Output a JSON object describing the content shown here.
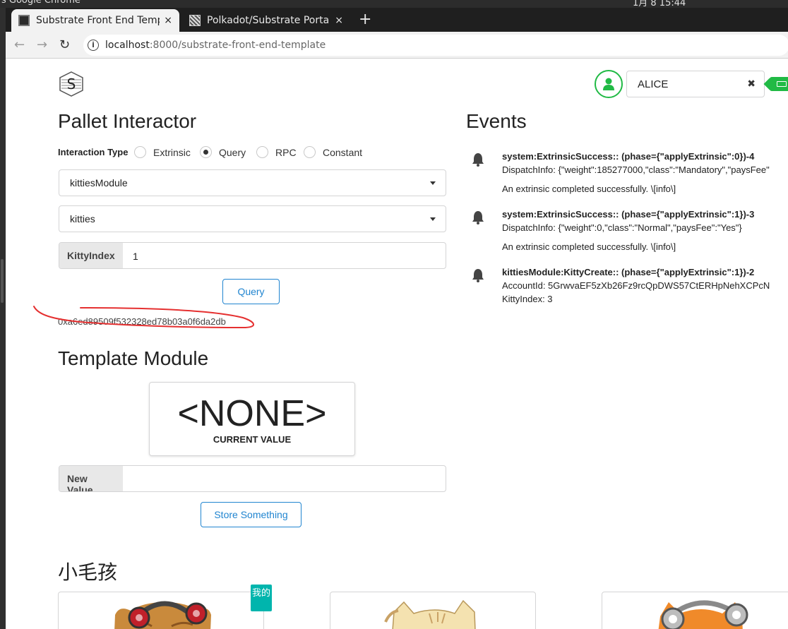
{
  "os": {
    "left_text": "s   Google Chrome",
    "right_text": "1月 8  15:44"
  },
  "tabs": [
    {
      "title": "Substrate Front End Temp",
      "close": "×"
    },
    {
      "title": "Polkadot/Substrate Porta",
      "close": "×"
    }
  ],
  "newtab_label": "+",
  "address": {
    "host": "localhost",
    "path": ":8000/substrate-front-end-template"
  },
  "account": {
    "name": "ALICE",
    "clear": "✖"
  },
  "pallet": {
    "title": "Pallet Interactor",
    "interaction_type_label": "Interaction Type",
    "radios": [
      "Extrinsic",
      "Query",
      "RPC",
      "Constant"
    ],
    "selected_radio": "Query",
    "module": "kittiesModule",
    "call": "kitties",
    "param_label": "KittyIndex",
    "param_value": "1",
    "query_button": "Query",
    "result": "0xa6ed89509f532328ed78b03a0f6da2db"
  },
  "template": {
    "title": "Template Module",
    "current_value": "<NONE>",
    "current_value_label": "CURRENT VALUE",
    "new_value_label": "New Value",
    "new_value": "",
    "store_button": "Store Something"
  },
  "events": {
    "title": "Events",
    "items": [
      {
        "title": "system:ExtrinsicSuccess:: (phase={\"applyExtrinsic\":0})-4",
        "line1": "DispatchInfo: {\"weight\":185277000,\"class\":\"Mandatory\",\"paysFee\"",
        "line2": "An extrinsic completed successfully. \\[info\\]"
      },
      {
        "title": "system:ExtrinsicSuccess:: (phase={\"applyExtrinsic\":1})-3",
        "line1": "DispatchInfo: {\"weight\":0,\"class\":\"Normal\",\"paysFee\":\"Yes\"}",
        "line2": "An extrinsic completed successfully. \\[info\\]"
      },
      {
        "title": "kittiesModule:KittyCreate:: (phase={\"applyExtrinsic\":1})-2",
        "line1": "AccountId: 5GrwvaEF5zXb26Fz9rcQpDWS57CtERHpNehXCPcN",
        "line2": "KittyIndex: 3"
      }
    ]
  },
  "kitties": {
    "title": "小毛孩",
    "mine_badge": "我的"
  },
  "colors": {
    "accent": "#2185d0",
    "green": "#21ba45",
    "teal": "#00b5ad",
    "scribble": "#e53030"
  }
}
